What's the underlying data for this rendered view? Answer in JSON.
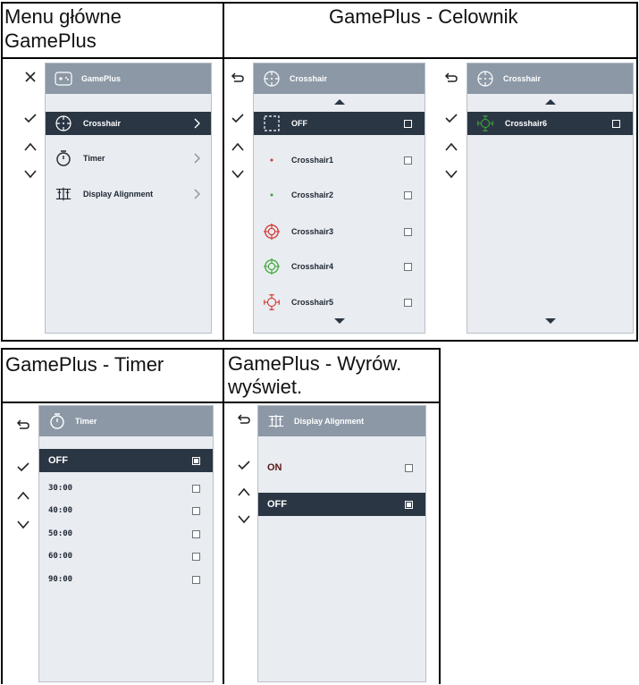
{
  "headers": {
    "main_menu": "Menu główne\nGamePlus",
    "crosshair": "GamePlus - Celownik",
    "timer": "GamePlus - Timer",
    "alignment": "GamePlus - Wyrów.\nwyświet."
  },
  "panel_main": {
    "title": "GamePlus",
    "items": [
      {
        "label": "Crosshair",
        "icon": "crosshair-icon"
      },
      {
        "label": "Timer",
        "icon": "stopwatch-icon"
      },
      {
        "label": "Display Alignment",
        "icon": "alignment-icon"
      }
    ]
  },
  "panel_crosshair_1": {
    "title": "Crosshair",
    "items": [
      {
        "label": "OFF"
      },
      {
        "label": "Crosshair1"
      },
      {
        "label": "Crosshair2"
      },
      {
        "label": "Crosshair3"
      },
      {
        "label": "Crosshair4"
      },
      {
        "label": "Crosshair5"
      }
    ]
  },
  "panel_crosshair_2": {
    "title": "Crosshair",
    "items": [
      {
        "label": "Crosshair6"
      }
    ]
  },
  "panel_timer": {
    "title": "Timer",
    "items": [
      "OFF",
      "30:00",
      "40:00",
      "50:00",
      "60:00",
      "90:00"
    ]
  },
  "panel_alignment": {
    "title": "Display Alignment",
    "items": [
      "ON",
      "OFF"
    ]
  },
  "colors": {
    "topbar": "#8c98a6",
    "selected": "#2b3644",
    "panel_bg": "#e9ecf0",
    "crosshair_red": "#d0312d",
    "crosshair_green": "#3aa635"
  }
}
